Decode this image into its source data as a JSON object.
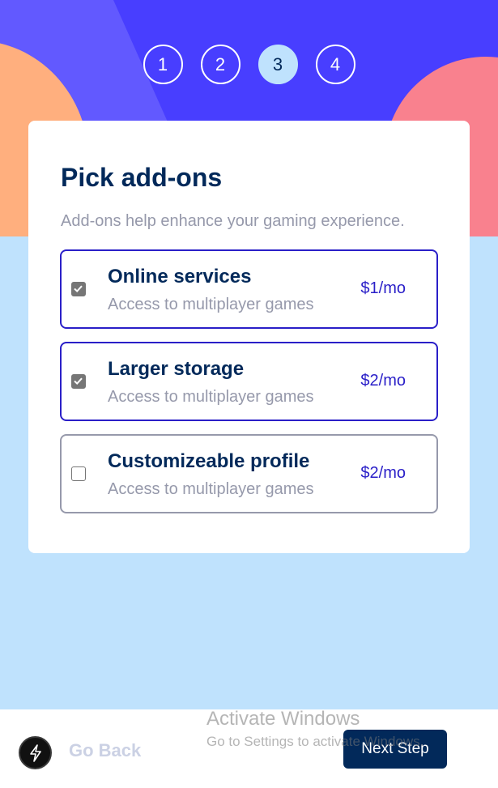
{
  "steps": [
    "1",
    "2",
    "3",
    "4"
  ],
  "active_step": "3",
  "card": {
    "title": "Pick add-ons",
    "subtitle": "Add-ons help enhance your gaming experience."
  },
  "addons": [
    {
      "name": "Online services",
      "description": "Access to multiplayer games",
      "price": "$1/mo",
      "checked": true
    },
    {
      "name": "Larger storage",
      "description": "Access to multiplayer games",
      "price": "$2/mo",
      "checked": true
    },
    {
      "name": "Customizeable profile",
      "description": "Access to multiplayer games",
      "price": "$2/mo",
      "checked": false
    }
  ],
  "footer": {
    "back_label": "Go Back",
    "next_label": "Next Step"
  },
  "watermark": {
    "title": "Activate Windows",
    "subtitle": "Go to Settings to activate Windows."
  },
  "colors": {
    "marine_blue": "#02295a",
    "purplish_blue": "#483eff",
    "light_blue": "#bfe2fd",
    "cool_gray": "#9699ab",
    "light_gray": "#cbd1e4",
    "selected_border": "#2a1fc8"
  },
  "icons": {
    "fab": "lightning-bolt-icon",
    "checkbox_checked": "checkmark-icon"
  }
}
